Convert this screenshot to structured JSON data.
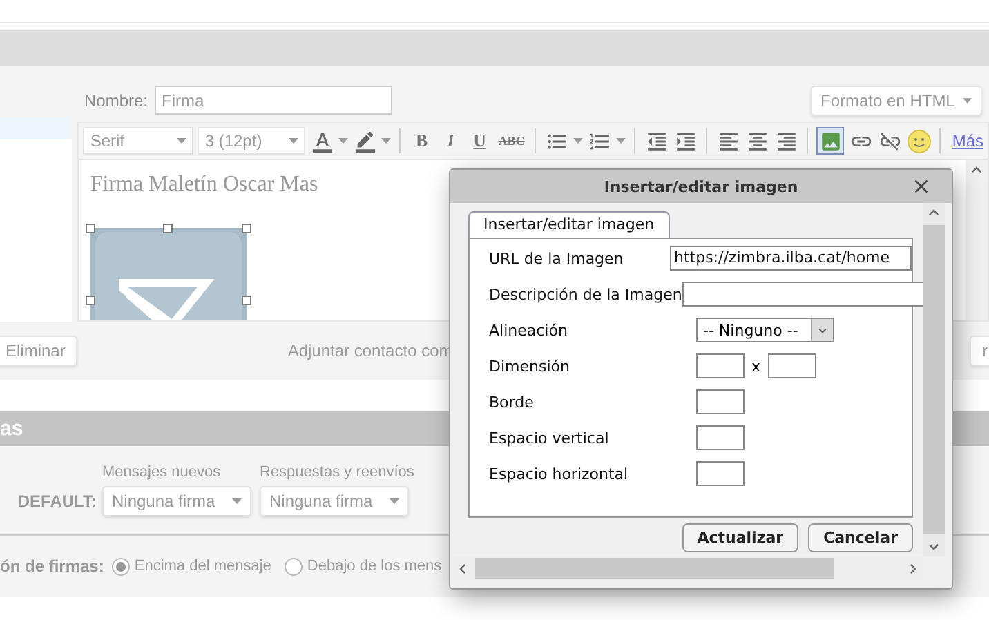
{
  "signature_form": {
    "name_label": "Nombre:",
    "name_value": "Firma",
    "format_select": "Formato en HTML",
    "toolbar": {
      "font": "Serif",
      "size": "3 (12pt)",
      "format_buttons": [
        "B",
        "I",
        "U",
        "ABC"
      ],
      "image_button": {
        "selected": true
      },
      "more_link": "Más"
    },
    "editor": {
      "text": "Firma Maletín Oscar Mas",
      "image": {
        "selected": true
      }
    },
    "sidebar": {
      "items": [
        {
          "selected": true
        }
      ]
    },
    "delete_button": "Eliminar",
    "attach_label": "Adjuntar contacto com",
    "right_button": "r"
  },
  "section": {
    "title": "as",
    "columns": [
      "Mensajes nuevos",
      "Respuestas y reenvíos"
    ],
    "account_label": "DEFAULT:",
    "selects": [
      "Ninguna firma",
      "Ninguna firma"
    ],
    "placement_label": "ón de firmas:",
    "placement_options": [
      {
        "label": "Encima del mensaje",
        "selected": true
      },
      {
        "label": "Debajo de los mens",
        "selected": false
      }
    ]
  },
  "dialog": {
    "title": "Insertar/editar imagen",
    "tabs": [
      {
        "label": "Insertar/editar imagen",
        "selected": true
      }
    ],
    "fields": [
      {
        "kind": "text",
        "label": "URL de la Imagen",
        "value": "https://zimbra.ilba.cat/home"
      },
      {
        "kind": "text",
        "label": "Descripción de la Imagen"
      },
      {
        "kind": "select",
        "label": "Alineación",
        "value": "-- Ninguno --"
      },
      {
        "kind": "dimension",
        "label": "Dimensión",
        "separator": "x"
      },
      {
        "kind": "small",
        "label": "Borde"
      },
      {
        "kind": "small",
        "label": "Espacio vertical"
      },
      {
        "kind": "small",
        "label": "Espacio horizontal"
      }
    ],
    "buttons": [
      "Actualizar",
      "Cancelar"
    ]
  }
}
